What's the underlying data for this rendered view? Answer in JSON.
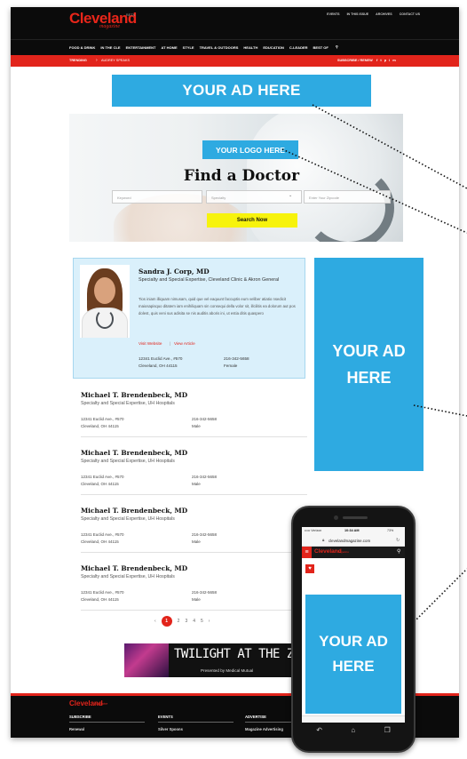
{
  "colors": {
    "brand_red": "#e2241b",
    "ad_blue": "#2eaae1",
    "featured_bg": "#daf0fb",
    "search_yellow": "#f7f30c",
    "dark": "#0b0b0b"
  },
  "header": {
    "logo": "Cleveland",
    "logo_beta": "BETA",
    "logo_sub": "magazine",
    "top_links": [
      "EVENTS",
      "IN THIS ISSUE",
      "ARCHIVES",
      "CONTACT US"
    ],
    "nav": [
      "FOOD & DRINK",
      "IN THE CLE",
      "ENTERTAINMENT",
      "AT HOME",
      "STYLE",
      "TRAVEL & OUTDOORS",
      "HEALTH",
      "EDUCATION",
      "C-LEADER",
      "BEST OF"
    ],
    "search_icon": "search-icon",
    "trending_label": "TRENDING",
    "trending_item": "AUDREY SPEAKS",
    "subscribe": "SUBSCRIBE / RENEW",
    "socials": [
      "f",
      "t",
      "p",
      "i",
      "m"
    ]
  },
  "ad_top": "YOUR AD HERE",
  "hero": {
    "logo_placeholder": "YOUR LOGO HERE",
    "title": "Find a Doctor",
    "keyword_placeholder": "Keyword",
    "specialty_placeholder": "Specialty",
    "zip_placeholder": "Enter Your Zipcode",
    "search_button": "Search Now"
  },
  "featured": {
    "name": "Sandra J. Corp, MD",
    "specialty": "Specialty and Special Expertise, Cleveland Clinic & Akron General",
    "bio": "Tios iniam illiquam nimusam, quid que vel eaquunt faccuptis eum veliber atiatio nsedicit maiosapisquo ditatem iam enihiliquam sin consequi della volor sit, illcilitis ea dolorum aut pos dolest, quis veni sus adisita se nis auditis aboris ini, ut estia ditis quaspero",
    "website_link": "Visit Website",
    "separator": "|",
    "article_link": "View Article",
    "address1": "12341 Euclid Ave., #570",
    "address2": "Cleveland, OH 44115",
    "phone": "216-342-5658",
    "gender": "Female"
  },
  "ad_side": {
    "line1": "YOUR AD",
    "line2": "HERE"
  },
  "doctors": [
    {
      "name": "Michael T. Brendenbeck, MD",
      "specialty": "Specialty and Special Expertise, UH Hospitals",
      "address1": "12341 Euclid Ave., #570",
      "address2": "Cleveland, OH 44115",
      "phone": "216-342-5658",
      "gender": "Male"
    },
    {
      "name": "Michael T. Brendenbeck, MD",
      "specialty": "Specialty and Special Expertise, UH Hospitals",
      "address1": "12341 Euclid Ave., #570",
      "address2": "Cleveland, OH 44115",
      "phone": "216-342-5658",
      "gender": "Male"
    },
    {
      "name": "Michael T. Brendenbeck, MD",
      "specialty": "Specialty and Special Expertise, UH Hospitals",
      "address1": "12341 Euclid Ave., #570",
      "address2": "Cleveland, OH 44115",
      "phone": "216-342-5658",
      "gender": "Male"
    },
    {
      "name": "Michael T. Brendenbeck, MD",
      "specialty": "Specialty and Special Expertise, UH Hospitals",
      "address1": "12341 Euclid Ave., #570",
      "address2": "Cleveland, OH 44115",
      "phone": "216-342-5658",
      "gender": "Male"
    }
  ],
  "pagination": {
    "prev": "‹",
    "pages": [
      "1",
      "2",
      "3",
      "4",
      "5"
    ],
    "active": "1",
    "next": "›"
  },
  "twilight": {
    "title": "TWILIGHT AT THE ZOO",
    "subtitle": "Presented by Medical Mutual"
  },
  "footer": {
    "logo": "Cleveland",
    "logo_sub": "magazine",
    "columns": [
      {
        "heading": "SUBSCRIBE",
        "item": "Renewal"
      },
      {
        "heading": "EVENTS",
        "item": "Silver Spoons"
      },
      {
        "heading": "ADVERTISE",
        "item": "Magazine Advertising"
      }
    ]
  },
  "phone": {
    "carrier": "••••• Verizon",
    "time": "10:34 AM",
    "battery": "73%",
    "url": "clevelandmagazine.com",
    "logo": "Cleveland",
    "logo_sub": "magazine",
    "ad_line1": "YOUR AD",
    "ad_line2": "HERE"
  }
}
